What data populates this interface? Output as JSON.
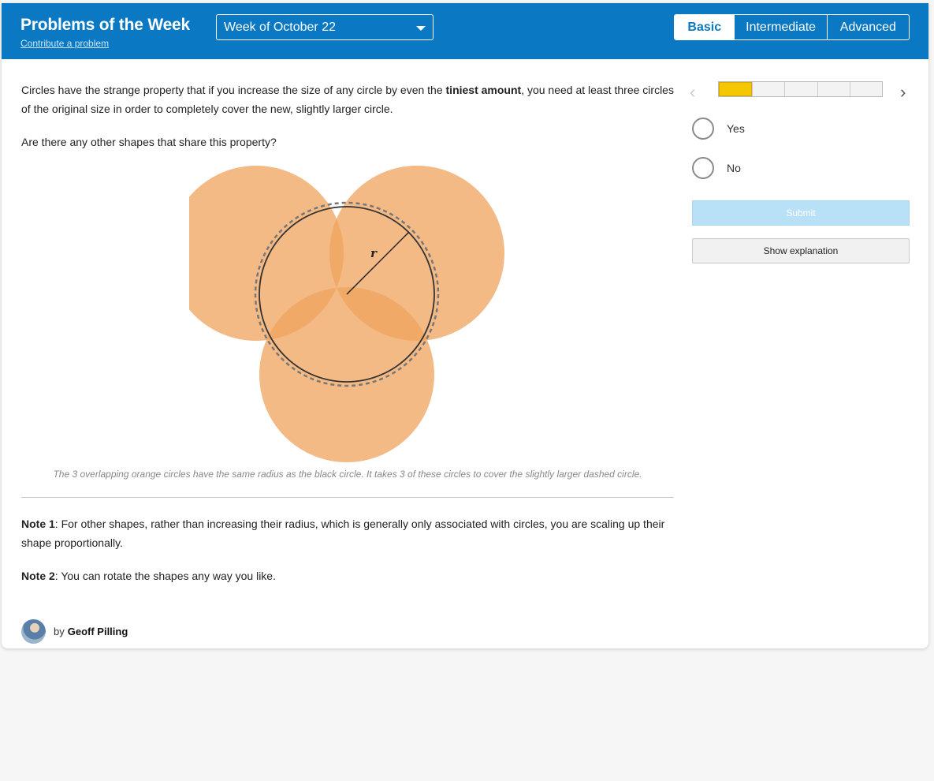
{
  "header": {
    "title": "Problems of the Week",
    "contribute_link": "Contribute a problem",
    "week_select": {
      "selected": "Week of October 22"
    },
    "levels": [
      "Basic",
      "Intermediate",
      "Advanced"
    ],
    "active_level": "Basic"
  },
  "problem": {
    "p1_before": "Circles have the strange property that if you increase the size of any circle by even the ",
    "p1_bold": "tiniest amount",
    "p1_after": ", you need at least three circles of the original size in order to completely cover the new, slightly larger circle.",
    "question": "Are there any other shapes that share this property?",
    "figure_radius_label": "r",
    "caption": "The 3 overlapping orange circles have the same radius as the black circle. It takes 3 of these circles to cover the slightly larger dashed circle.",
    "note1_label": "Note 1",
    "note1_text": ": For other shapes, rather than increasing their radius, which is generally only associated with circles, you are scaling up their shape proportionally.",
    "note2_label": "Note 2",
    "note2_text": ": You can rotate the shapes any way you like."
  },
  "author": {
    "by": "by",
    "name": "Geoff Pilling"
  },
  "sidebar": {
    "progress": {
      "current": 1,
      "total": 5
    },
    "options": [
      "Yes",
      "No"
    ],
    "submit_label": "Submit",
    "explanation_label": "Show explanation"
  },
  "colors": {
    "header_blue": "#0a78c2",
    "progress_yellow": "#f4c700",
    "circle_orange": "#f0a35e",
    "submit_disabled": "#b8e0f6"
  }
}
